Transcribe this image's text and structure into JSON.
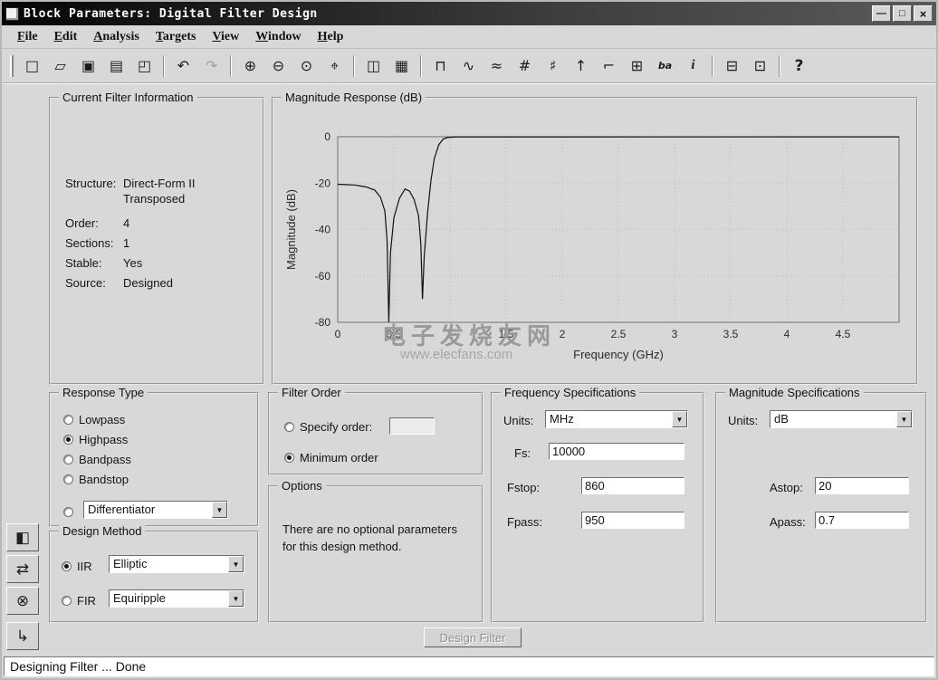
{
  "window": {
    "title": "Block Parameters: Digital Filter Design",
    "controls": {
      "minimize_icon": "—",
      "restore_icon": "□",
      "close_icon": "×"
    }
  },
  "menu": {
    "items": [
      {
        "name": "menu-file",
        "label": "File"
      },
      {
        "name": "menu-edit",
        "label": "Edit"
      },
      {
        "name": "menu-analysis",
        "label": "Analysis"
      },
      {
        "name": "menu-targets",
        "label": "Targets"
      },
      {
        "name": "menu-view",
        "label": "View"
      },
      {
        "name": "menu-window",
        "label": "Window"
      },
      {
        "name": "menu-help",
        "label": "Help"
      }
    ]
  },
  "toolbar": {
    "items": [
      {
        "name": "new-file-button",
        "glyph": "□"
      },
      {
        "name": "open-file-button",
        "glyph": "▱"
      },
      {
        "name": "save-button",
        "glyph": "▣"
      },
      {
        "name": "print-button",
        "glyph": "▤"
      },
      {
        "name": "print-preview-button",
        "glyph": "◰"
      },
      {
        "type": "sep"
      },
      {
        "name": "undo-button",
        "glyph": "↶"
      },
      {
        "name": "redo-button",
        "glyph": "↷",
        "disabled": true
      },
      {
        "type": "sep"
      },
      {
        "name": "zoom-in-button",
        "glyph": "⊕"
      },
      {
        "name": "zoom-out-button",
        "glyph": "⊖"
      },
      {
        "name": "zoom-default-button",
        "glyph": "⊙"
      },
      {
        "name": "full-view-button",
        "glyph": "⌖"
      },
      {
        "type": "sep"
      },
      {
        "name": "copy-figure-button",
        "glyph": "◫"
      },
      {
        "name": "fda-link-button",
        "glyph": "▦"
      },
      {
        "type": "sep"
      },
      {
        "name": "magnitude-response-button",
        "glyph": "⊓"
      },
      {
        "name": "phase-response-button",
        "glyph": "∿"
      },
      {
        "name": "mag-phase-response-button",
        "glyph": "≈"
      },
      {
        "name": "group-delay-button",
        "glyph": "#"
      },
      {
        "name": "phase-delay-button",
        "glyph": "♯"
      },
      {
        "name": "impulse-response-button",
        "glyph": "↑"
      },
      {
        "name": "step-response-button",
        "glyph": "⌐"
      },
      {
        "name": "pole-zero-plot-button",
        "glyph": "⊞"
      },
      {
        "name": "filter-coefficients-button",
        "glyph": "ba",
        "cls": "txt"
      },
      {
        "name": "filter-info-button",
        "glyph": "i",
        "cls": "round"
      },
      {
        "type": "sep"
      },
      {
        "name": "realize-model-button",
        "glyph": "⊟"
      },
      {
        "name": "sos-scaling-button",
        "glyph": "⊡"
      },
      {
        "type": "sep"
      },
      {
        "name": "whats-this-help-button",
        "glyph": "?",
        "cls": "bold"
      }
    ]
  },
  "filter_info": {
    "title": "Current Filter Information",
    "structure_label": "Structure:",
    "structure_value": "Direct-Form II",
    "structure_value2": "Transposed",
    "order_label": "Order:",
    "order_value": "4",
    "sections_label": "Sections:",
    "sections_value": "1",
    "stable_label": "Stable:",
    "stable_value": "Yes",
    "source_label": "Source:",
    "source_value": "Designed"
  },
  "magnitude_response": {
    "title": "Magnitude Response (dB)",
    "watermark_line1": "电子发烧友网",
    "watermark_line2": "www.elecfans.com"
  },
  "chart_data": {
    "type": "line",
    "title": "Magnitude Response (dB)",
    "xlabel": "Frequency (GHz)",
    "ylabel": "Magnitude (dB)",
    "xlim": [
      0,
      5
    ],
    "ylim": [
      0,
      -80
    ],
    "xticks": [
      0,
      0.5,
      1,
      1.5,
      2,
      2.5,
      3,
      3.5,
      4,
      4.5
    ],
    "yticks": [
      0,
      -20,
      -40,
      -60,
      -80
    ],
    "grid": true,
    "legend": null,
    "series": [
      {
        "name": "elliptic highpass magnitude response",
        "points": [
          [
            0,
            -20.5
          ],
          [
            0.15,
            -20.8
          ],
          [
            0.25,
            -21.6
          ],
          [
            0.33,
            -23
          ],
          [
            0.38,
            -26
          ],
          [
            0.42,
            -32
          ],
          [
            0.44,
            -45
          ],
          [
            0.455,
            -80
          ],
          [
            0.47,
            -50
          ],
          [
            0.5,
            -35
          ],
          [
            0.55,
            -26.5
          ],
          [
            0.6,
            -22.5
          ],
          [
            0.64,
            -23.5
          ],
          [
            0.68,
            -27
          ],
          [
            0.72,
            -34
          ],
          [
            0.74,
            -46
          ],
          [
            0.755,
            -70
          ],
          [
            0.77,
            -52
          ],
          [
            0.8,
            -33
          ],
          [
            0.83,
            -19
          ],
          [
            0.86,
            -9.5
          ],
          [
            0.9,
            -3.5
          ],
          [
            0.94,
            -1
          ],
          [
            0.98,
            -0.3
          ],
          [
            1.05,
            -0.1
          ],
          [
            5,
            -0.05
          ]
        ]
      }
    ]
  },
  "response_type": {
    "title": "Response Type",
    "options": [
      {
        "label": "Lowpass",
        "selected": false
      },
      {
        "label": "Highpass",
        "selected": true
      },
      {
        "label": "Bandpass",
        "selected": false
      },
      {
        "label": "Bandstop",
        "selected": false
      }
    ],
    "differentiator": {
      "selected": false,
      "value": "Differentiator"
    }
  },
  "design_method": {
    "title": "Design Method",
    "iir": {
      "label": "IIR",
      "selected": true,
      "value": "Elliptic"
    },
    "fir": {
      "label": "FIR",
      "selected": false,
      "value": "Equiripple"
    }
  },
  "filter_order": {
    "title": "Filter Order",
    "specify": {
      "label": "Specify order:",
      "selected": false,
      "value": ""
    },
    "minimum": {
      "label": "Minimum order",
      "selected": true
    }
  },
  "options_panel": {
    "title": "Options",
    "text": "There are no optional parameters for this design method."
  },
  "frequency_specs": {
    "title": "Frequency Specifications",
    "units_label": "Units:",
    "units_value": "MHz",
    "fs": {
      "label": "Fs:",
      "value": "10000"
    },
    "fstop": {
      "label": "Fstop:",
      "value": "860"
    },
    "fpass": {
      "label": "Fpass:",
      "value": "950"
    }
  },
  "magnitude_specs": {
    "title": "Magnitude Specifications",
    "units_label": "Units:",
    "units_value": "dB",
    "astop": {
      "label": "Astop:",
      "value": "20"
    },
    "apass": {
      "label": "Apass:",
      "value": "0.7"
    }
  },
  "sidebar": {
    "buttons": [
      {
        "name": "set-quantization-button",
        "glyph": "◧"
      },
      {
        "name": "transform-filter-button",
        "glyph": "⇄"
      },
      {
        "name": "pole-zero-editor-button",
        "glyph": "⊗"
      },
      {
        "name": "import-filter-button",
        "glyph": "↳"
      }
    ]
  },
  "design_button": {
    "label": "Design Filter",
    "enabled": false
  },
  "status": {
    "text": "Designing Filter ... Done"
  }
}
